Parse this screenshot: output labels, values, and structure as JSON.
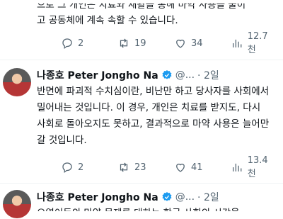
{
  "previous_tweet": {
    "text_line1": "으로 그 개인은 치료와 재활을 통해 마약 사용을 줄이",
    "text_line2": "고 공동체에 계속 속할 수 있습니다.",
    "reply_count": "2",
    "retweet_count": "19",
    "like_count": "34",
    "views": "12.7천"
  },
  "tweet": {
    "author_name": "나종호 Peter Jongho Na",
    "handle": "@...",
    "time": "· 2일",
    "text": "반면에 파괴적 수치심이란, 비난만 하고 당사자를 사회에서 밀어내는 것입니다. 이 경우, 개인은 치료를 받지도, 다시 사회로 돌아오지도 못하고, 결과적으로 마약 사용은 늘어만 갈 것입니다.",
    "reply_count": "2",
    "retweet_count": "23",
    "like_count": "41",
    "views": "13.4천"
  },
  "next_tweet": {
    "author_name": "나종호 Peter Jongho Na",
    "handle": "@...",
    "time": "· 2일",
    "text_preview": "오염이든의 마약 문제를 대하는 한국 사회의 시각을"
  },
  "colors": {
    "verified": "#1d9bf0",
    "muted": "#536471",
    "divider": "#eff3f4"
  }
}
